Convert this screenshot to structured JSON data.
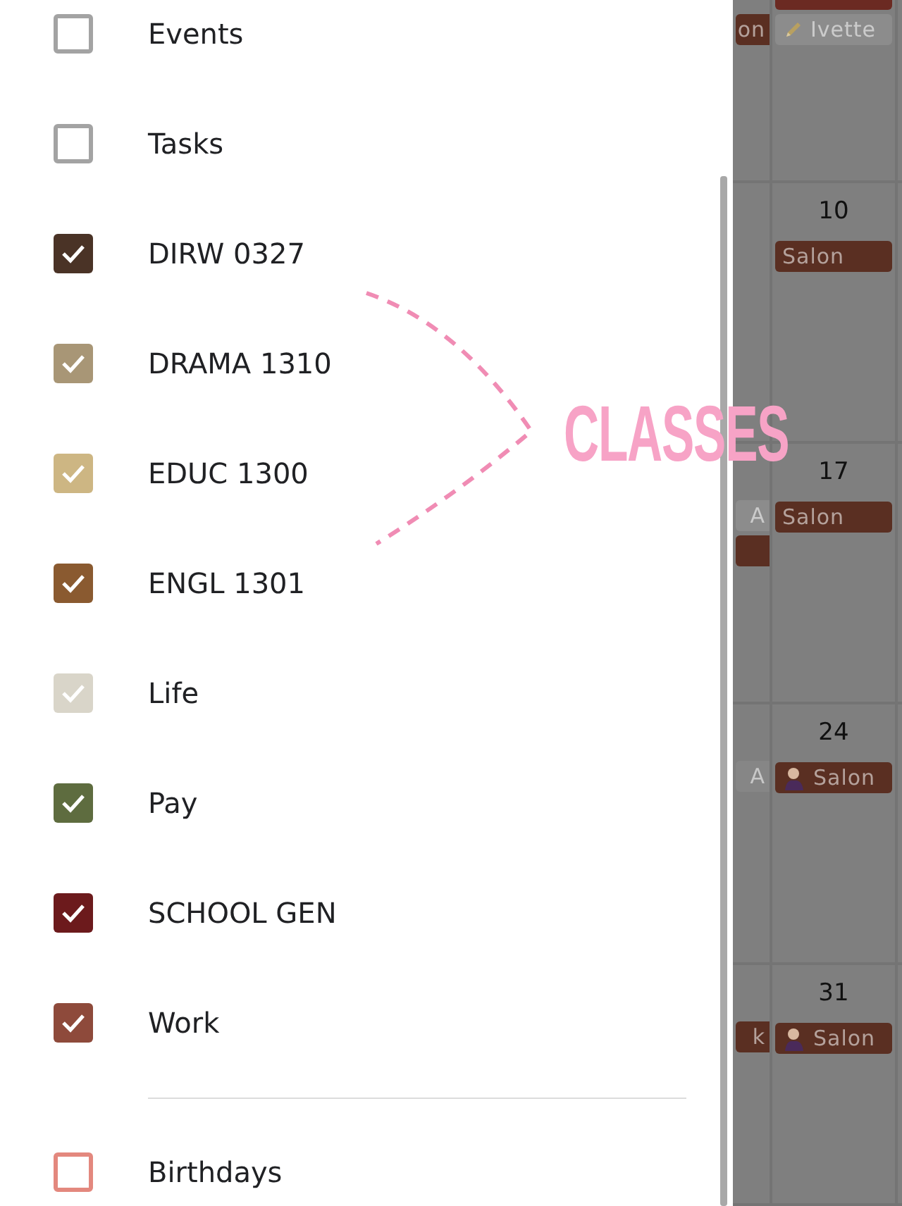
{
  "calendars": [
    {
      "label": "Events",
      "checked": false,
      "color": "#a3a3a3"
    },
    {
      "label": "Tasks",
      "checked": false,
      "color": "#a3a3a3"
    },
    {
      "label": "DIRW 0327",
      "checked": true,
      "color": "#4a3326"
    },
    {
      "label": "DRAMA 1310",
      "checked": true,
      "color": "#a89676"
    },
    {
      "label": "EDUC 1300",
      "checked": true,
      "color": "#cdb683"
    },
    {
      "label": "ENGL 1301",
      "checked": true,
      "color": "#8a5a30"
    },
    {
      "label": "Life",
      "checked": true,
      "color": "#d9d5c9"
    },
    {
      "label": "Pay",
      "checked": true,
      "color": "#5e6c3f"
    },
    {
      "label": "SCHOOL GEN",
      "checked": true,
      "color": "#6c1a1c"
    },
    {
      "label": "Work",
      "checked": true,
      "color": "#8e4a3b"
    }
  ],
  "other_calendars": [
    {
      "label": "Birthdays",
      "checked": false,
      "color": "#e3887e"
    }
  ],
  "annotation": {
    "text": "CLASSES"
  },
  "weeks": [
    {
      "left_events": [
        {
          "title": "on",
          "color": "#5a2f22"
        }
      ],
      "events": [
        {
          "kind": "cut",
          "color": "#6b2a22"
        },
        {
          "kind": "pencil",
          "title": "Ivette",
          "color": "#8c8c8c"
        }
      ]
    },
    {
      "date": "10",
      "events": [
        {
          "kind": "plain",
          "title": "Salon",
          "color": "#5a2f22"
        }
      ]
    },
    {
      "date": "17",
      "left_events": [
        {
          "title": "A",
          "color": "#8c8c8c"
        },
        {
          "color": "#5a2f22"
        }
      ],
      "events": [
        {
          "kind": "plain",
          "title": "Salon",
          "color": "#5a2f22"
        }
      ]
    },
    {
      "date": "24",
      "left_events": [
        {
          "title": "A",
          "color": "#868686"
        }
      ],
      "events": [
        {
          "kind": "person",
          "title": "Salon",
          "color": "#5a2f22"
        }
      ]
    },
    {
      "date": "31",
      "left_events": [
        {
          "title": "k",
          "color": "#5a2f22"
        }
      ],
      "events": [
        {
          "kind": "person",
          "title": "Salon",
          "color": "#5a2f22"
        }
      ]
    }
  ]
}
